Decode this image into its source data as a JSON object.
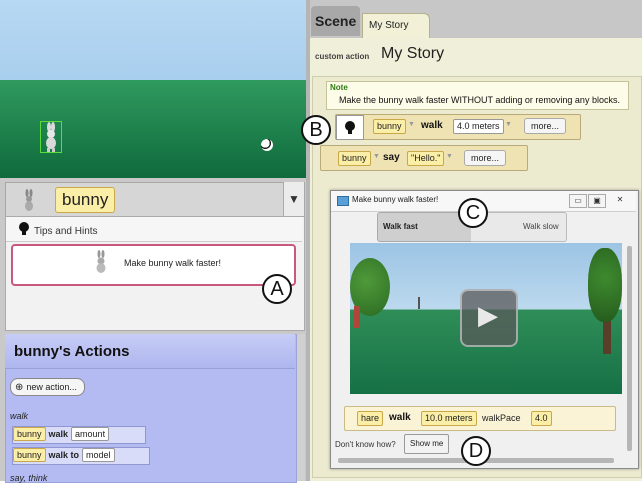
{
  "viewport": {
    "bunny_icon": "bunny-sprite-icon",
    "ball_icon": "soccer-ball-icon"
  },
  "selector": {
    "icon": "bunny-icon",
    "name": "bunny",
    "arrow": "▼"
  },
  "tips": {
    "icon": "lightbulb-icon",
    "title": "Tips and Hints",
    "hint_icon": "bunny-icon",
    "hint_text": "Make bunny walk faster!"
  },
  "actions": {
    "title": "bunny's Actions",
    "new_action_label": "new action...",
    "categories": {
      "walk": "walk",
      "say": "say, think"
    },
    "walk_row": {
      "object": "bunny",
      "verb": "walk",
      "param": "amount"
    },
    "walk_to_row": {
      "object": "bunny",
      "verb": "walk to",
      "param": "model"
    }
  },
  "tabs": {
    "scene": "Scene",
    "mystory": "My Story"
  },
  "editor": {
    "custom_label": "custom action",
    "custom_name": "My Story",
    "note_title": "Note",
    "note_text": "Make the bunny walk faster WITHOUT adding or removing any blocks.",
    "walk_stmt": {
      "object": "bunny",
      "verb": "walk",
      "distance": "4.0 meters",
      "more": "more..."
    },
    "say_stmt": {
      "object": "bunny",
      "verb": "say",
      "text": "\"Hello.\"",
      "more": "more..."
    }
  },
  "popup": {
    "title": "Make bunny walk faster!",
    "toggle_fast": "Walk fast",
    "toggle_slow": "Walk slow",
    "play_icon": "play-icon",
    "code": {
      "object": "hare",
      "verb": "walk",
      "distance": "10.0 meters",
      "param_name": "walkPace",
      "param_value": "4.0"
    },
    "hint_label": "Don't know how?",
    "show_me": "Show me"
  },
  "markers": {
    "a": "A",
    "b": "B",
    "c": "C",
    "d": "D"
  },
  "colors": {
    "object_chip": "#fbeea6",
    "hint_border": "#c9587e",
    "actions_panel": "#b3bbf2",
    "editor_bg": "#f0efd9",
    "note_title": "#2a7c10"
  }
}
